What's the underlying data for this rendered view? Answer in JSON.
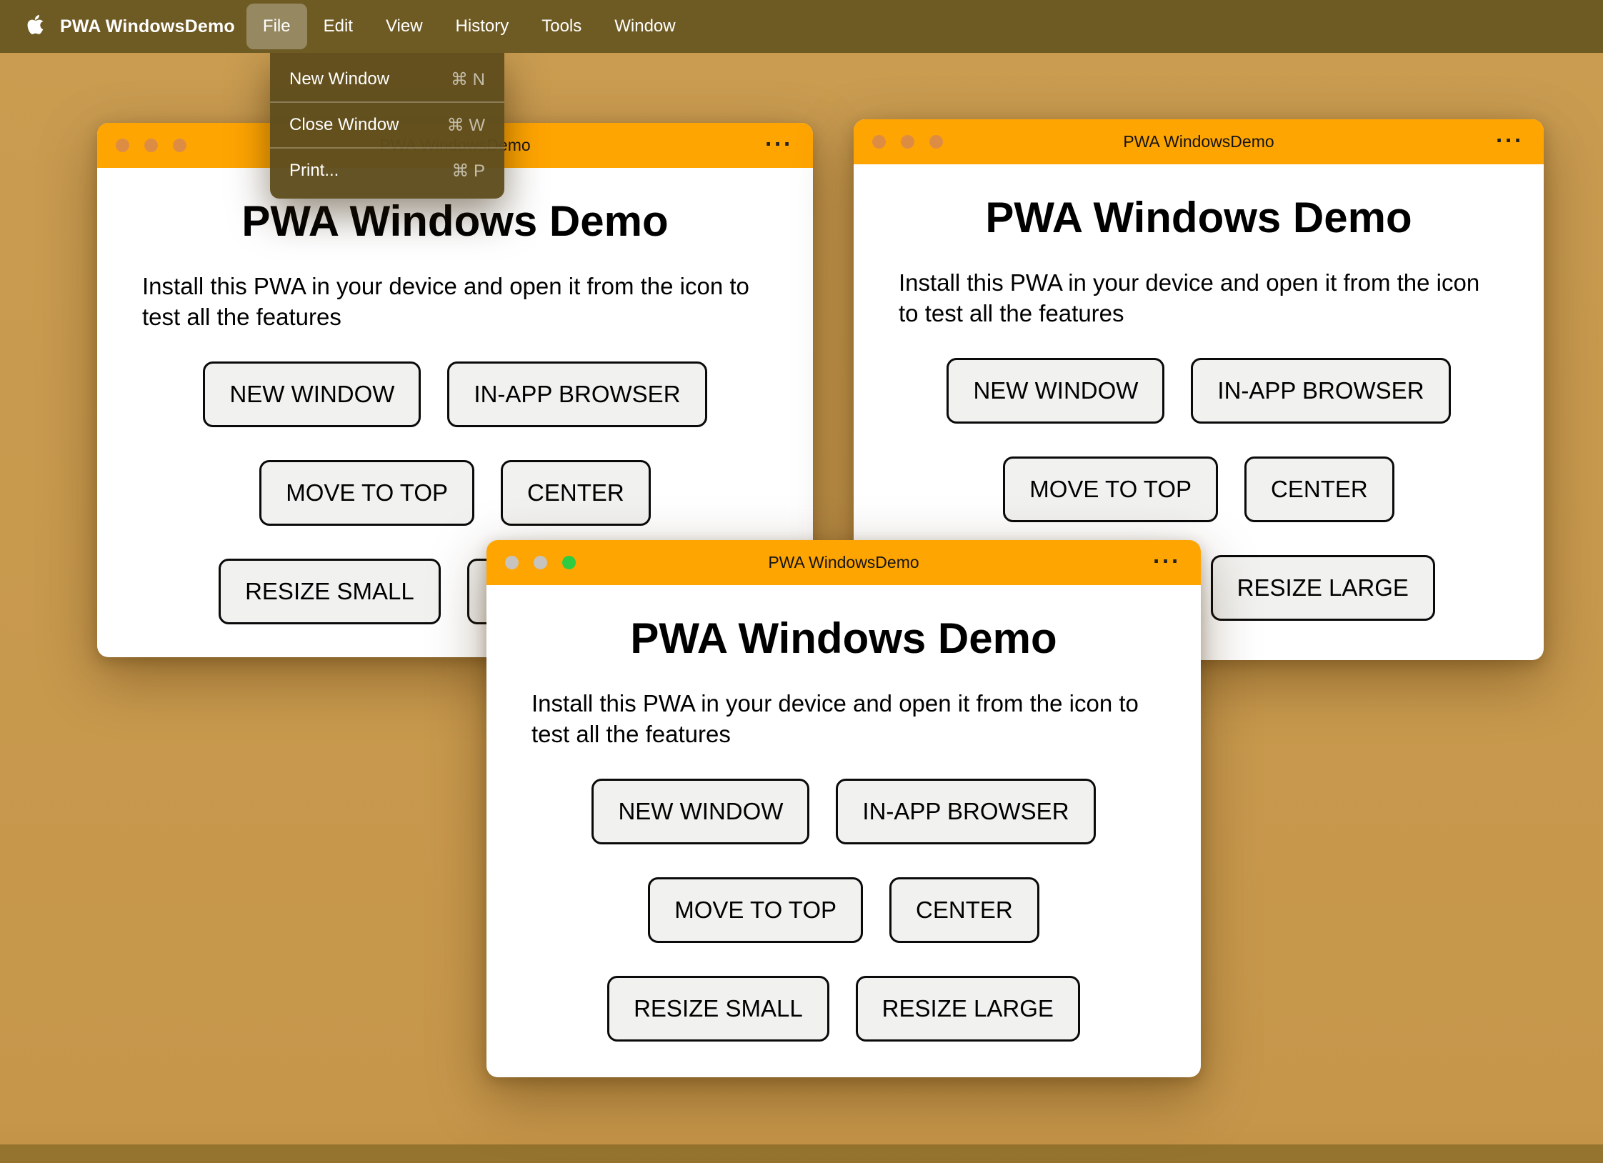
{
  "menu_bar": {
    "app_name": "PWA WindowsDemo",
    "menus": [
      "File",
      "Edit",
      "View",
      "History",
      "Tools",
      "Window"
    ],
    "active_menu": "File"
  },
  "file_menu": {
    "items": [
      {
        "label": "New Window",
        "shortcut": "⌘ N"
      },
      {
        "label": "Close Window",
        "shortcut": "⌘ W"
      },
      {
        "label": "Print...",
        "shortcut": "⌘ P"
      }
    ]
  },
  "window_chrome": {
    "overflow_menu": "···"
  },
  "windows": [
    {
      "title": "PWA WindowsDemo"
    },
    {
      "title": "PWA WindowsDemo"
    },
    {
      "title": "PWA WindowsDemo"
    }
  ],
  "window_content": {
    "heading": "PWA Windows Demo",
    "description": "Install this PWA in your device and open it from the icon to test all the features",
    "buttons": [
      "NEW WINDOW",
      "IN-APP BROWSER",
      "MOVE TO TOP",
      "CENTER",
      "RESIZE SMALL",
      "RESIZE LARGE"
    ]
  },
  "colors": {
    "desktop": "#c99b4f",
    "menu_bar": "#6e5a23",
    "dropdown_bg": "#5f4d1d",
    "titlebar_orange": "#ffa502",
    "window_bg": "#ffffff",
    "button_bg": "#f1f1ef",
    "button_border": "#0a0a0a",
    "inactive_light": "#dd8d43",
    "active_green_light": "#2fcb41"
  }
}
